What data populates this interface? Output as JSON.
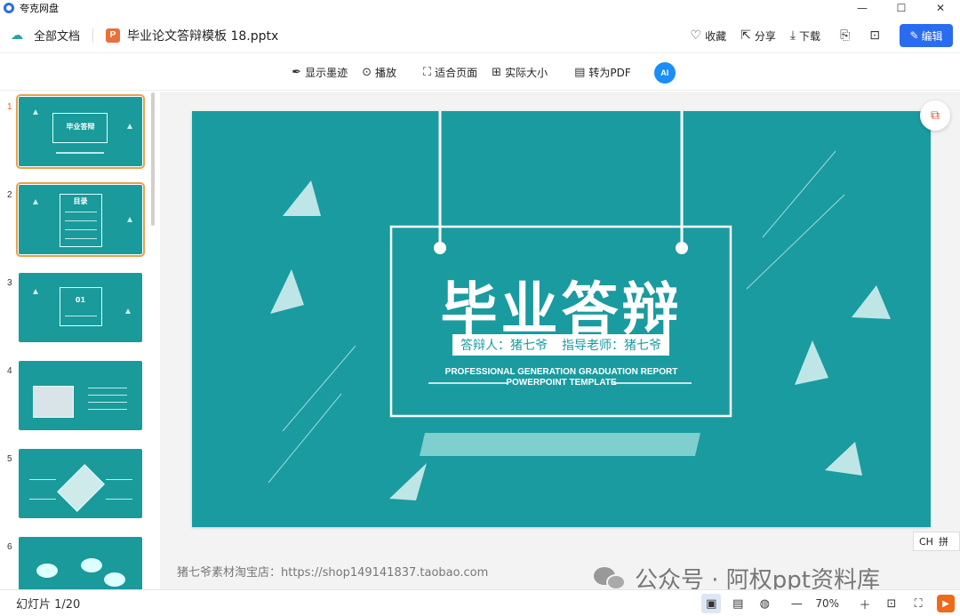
{
  "app": {
    "title": "夸克网盘"
  },
  "window": {
    "minimize": "—",
    "maximize": "☐",
    "close": "✕"
  },
  "file_bar": {
    "all_docs": "全部文档",
    "file_name": "毕业论文答辩模板 18.pptx",
    "ppt_badge": "P",
    "favorite": "收藏",
    "share": "分享",
    "download": "下载",
    "edit": "编辑"
  },
  "viewer_toolbar": {
    "show_ink": "显示墨迹",
    "play": "播放",
    "fit_page": "适合页面",
    "actual_size": "实际大小",
    "to_pdf": "转为PDF",
    "ai": "AI"
  },
  "thumbnails": [
    {
      "num": "1",
      "title": "毕业答辩",
      "selected": true
    },
    {
      "num": "2",
      "title": "目录",
      "selected": true
    },
    {
      "num": "3",
      "title": "01"
    },
    {
      "num": "4",
      "title": ""
    },
    {
      "num": "5",
      "title": ""
    },
    {
      "num": "6",
      "title": ""
    }
  ],
  "slide": {
    "title": "毕业答辩",
    "defender": "答辩人：猪七爷",
    "advisor": "指导老师：猪七爷",
    "en_line1": "PROFESSIONAL GENERATION GRADUATION REPORT",
    "en_line2": "POWERPOINT TEMPLATE",
    "bg_color": "#1a9ba0"
  },
  "notes": {
    "shop": "猪七爷素材淘宝店：https://shop149141837.taobao.com"
  },
  "watermark": {
    "text": "公众号 · 阿权ppt资料库"
  },
  "ime": {
    "lang": "CH",
    "mode": "拼"
  },
  "status_bar": {
    "slide_count": "幻灯片 1/20",
    "zoom": "70%"
  }
}
